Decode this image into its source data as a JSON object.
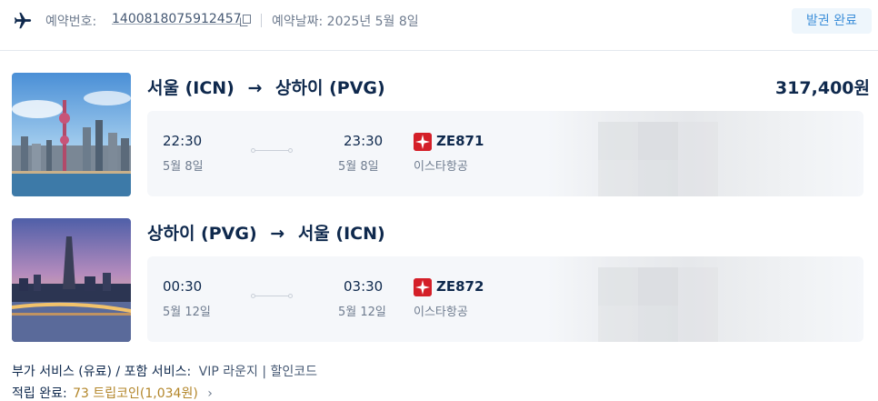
{
  "header": {
    "booking_label": "예약번호:",
    "booking_number": "1400818075912457",
    "date_label": "예약날짜: 2025년 5월 8일",
    "status": "발권 완료"
  },
  "trips": [
    {
      "route_from": "서울 (ICN)",
      "arrow": "→",
      "route_to": "상하이 (PVG)",
      "price": "317,400원",
      "dep_time": "22:30",
      "dep_date": "5월 8일",
      "arr_time": "23:30",
      "arr_date": "5월 8일",
      "flight_no": "ZE871",
      "airline": "이스타항공"
    },
    {
      "route_from": "상하이 (PVG)",
      "arrow": "→",
      "route_to": "서울 (ICN)",
      "dep_time": "00:30",
      "dep_date": "5월 12일",
      "arr_time": "03:30",
      "arr_date": "5월 12일",
      "flight_no": "ZE872",
      "airline": "이스타항공"
    }
  ],
  "footer": {
    "services_label": "부가 서비스 (유료) / 포함 서비스:",
    "services_value": "VIP 라운지 | 할인코드",
    "points_label": "적립 완료:",
    "points_value": "73 트립코인(1,034원)",
    "chevron": "›"
  },
  "colors": {
    "brand_text": "#0f294d",
    "status_blue": "#3d8fd9",
    "airline_red": "#d41f28",
    "coin_gold": "#b3862a"
  },
  "icons": [
    "plane-icon",
    "copy-icon",
    "airline-logo-icon",
    "chevron-right-icon"
  ]
}
